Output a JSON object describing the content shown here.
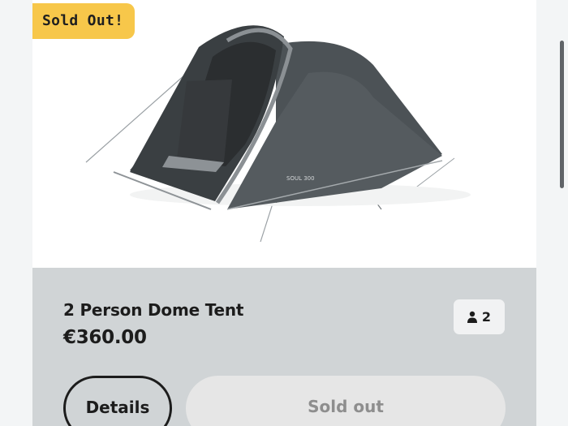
{
  "badge": {
    "label": "Sold Out!"
  },
  "product": {
    "image_alt": "Grey two-person dome tent",
    "tent_print": "SOUL 300",
    "title": "2 Person Dome Tent",
    "price": "€360.00",
    "capacity": "2",
    "capacity_icon": "person-icon"
  },
  "actions": {
    "details_label": "Details",
    "sold_out_label": "Sold out"
  },
  "colors": {
    "badge": "#f7c74a",
    "info_background": "#d0d4d6",
    "sold_out_button": "#e6e6e6"
  }
}
